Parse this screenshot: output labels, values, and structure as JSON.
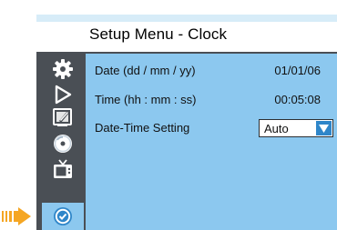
{
  "title": "Setup Menu - Clock",
  "sidebar": {
    "items": [
      {
        "icon": "gear-icon"
      },
      {
        "icon": "play-icon"
      },
      {
        "icon": "edit-monitor-icon"
      },
      {
        "icon": "disc-icon"
      },
      {
        "icon": "tv-icon"
      },
      {
        "icon": "clock-icon",
        "active": true
      }
    ]
  },
  "settings": [
    {
      "label": "Date (dd / mm / yy)",
      "value": "01/01/06"
    },
    {
      "label": "Time (hh : mm : ss)",
      "value": "00:05:08"
    },
    {
      "label": "Date-Time Setting",
      "value": "Auto",
      "control": "dropdown"
    }
  ],
  "colors": {
    "panel": "#8cc8ef",
    "sidebar": "#4a4f55",
    "pointer": "#f5a623",
    "accent": "#2f86c9"
  }
}
